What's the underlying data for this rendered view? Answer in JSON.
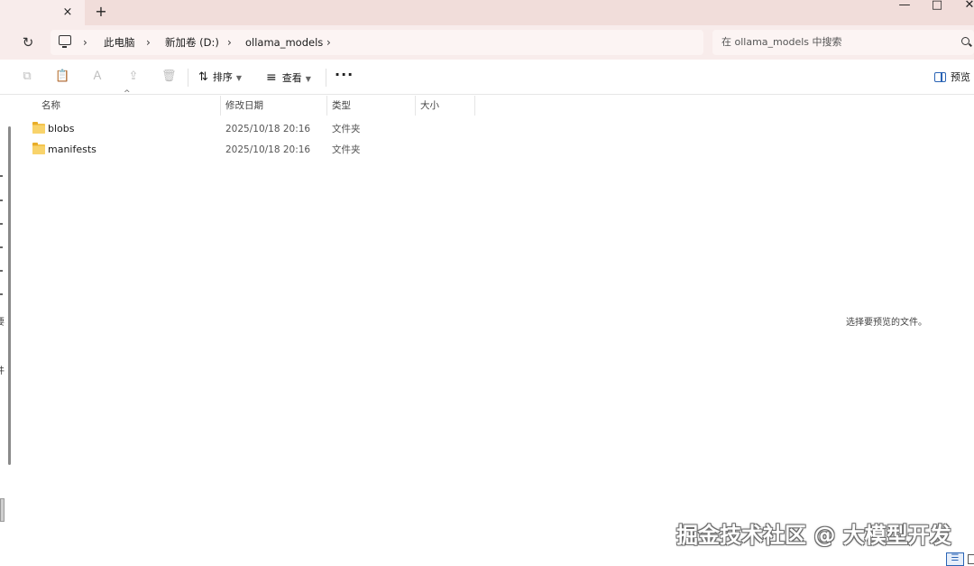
{
  "tabs": {
    "close_icon": "×",
    "new_tab_icon": "+"
  },
  "window_controls": {
    "minimize": "—",
    "maximize": "□",
    "close": "✕"
  },
  "address": {
    "refresh_icon": "↻",
    "breadcrumbs": [
      "此电脑",
      "新加卷 (D:)",
      "ollama_models"
    ],
    "chevron": "›"
  },
  "search": {
    "placeholder": "在 ollama_models 中搜索"
  },
  "toolbar": {
    "copy_icon": "⧉",
    "paste_icon": "📋",
    "rename_icon": "Ａ",
    "share_icon": "⇪",
    "delete_icon": "🗑",
    "sort_label": "排序",
    "sort_icon": "⇅",
    "view_label": "查看",
    "view_icon": "≡",
    "more_label": "···",
    "preview_label": "预览"
  },
  "columns": [
    "名称",
    "修改日期",
    "类型",
    "大小"
  ],
  "sort_indicator": "^",
  "files": [
    {
      "name": "blobs",
      "modified": "2025/10/18 20:16",
      "type": "文件夹"
    },
    {
      "name": "manifests",
      "modified": "2025/10/18 20:16",
      "type": "文件夹"
    }
  ],
  "nav_fragments": [
    "要",
    "件"
  ],
  "preview_pane": {
    "message": "选择要预览的文件。"
  },
  "watermark": "掘金技术社区 @ 大模型开发",
  "status_view": {
    "details_icon": "☰"
  }
}
